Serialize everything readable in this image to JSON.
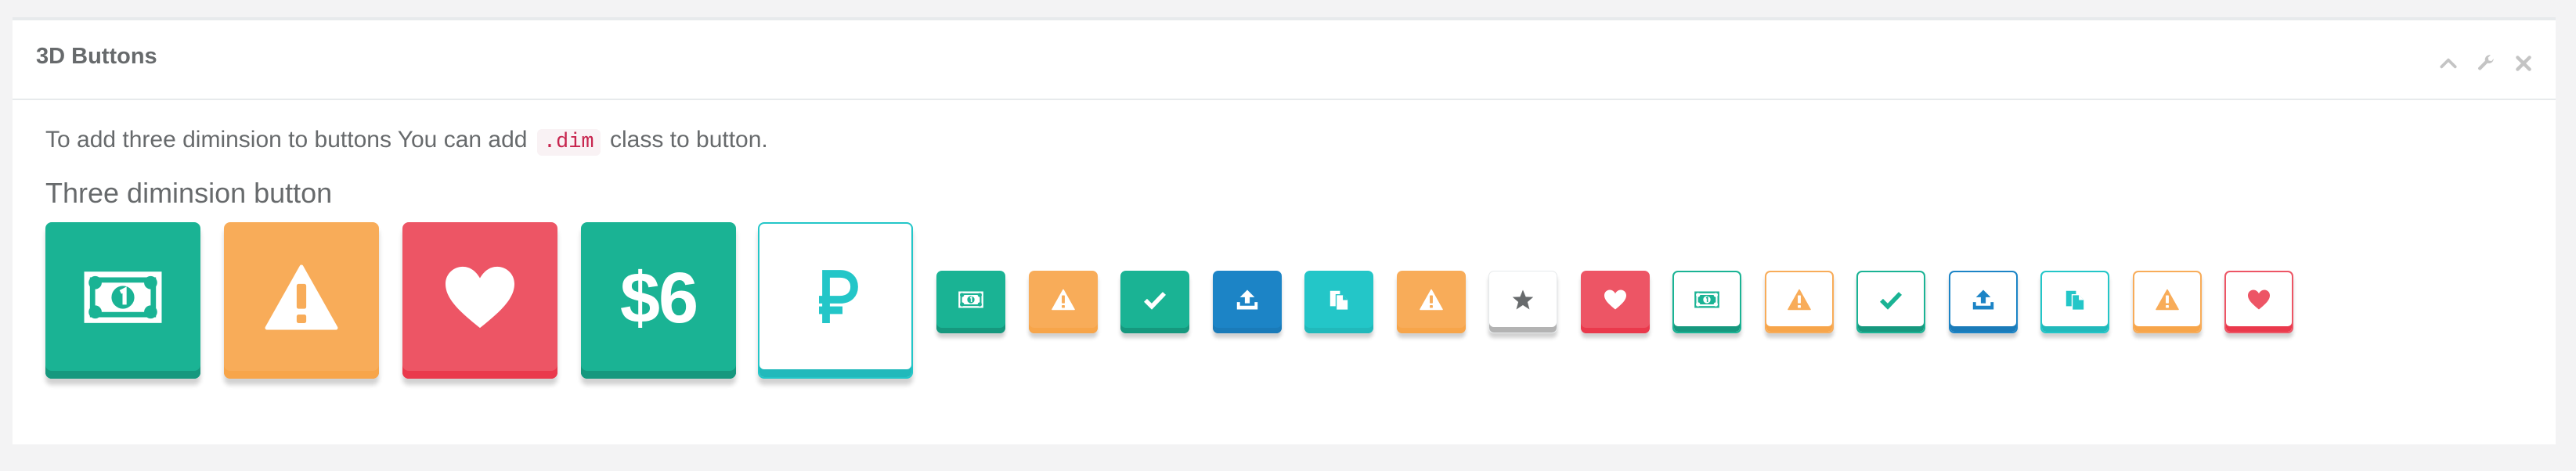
{
  "panel": {
    "title": "3D Buttons",
    "tools": [
      "chevron-up-icon",
      "wrench-icon",
      "close-icon"
    ]
  },
  "content": {
    "description_before": "To add three diminsion to buttons You can add",
    "code": ".dim",
    "description_after": "class to button.",
    "subheading": "Three diminsion button"
  },
  "colors": {
    "primary": "#1ab394",
    "primary_dark": "#16987e",
    "warning": "#f8ac59",
    "warning_dark": "#f7a54a",
    "danger": "#ed5565",
    "danger_dark": "#ea394c",
    "success": "#1c84c6",
    "success_dark": "#1a7bb9",
    "info": "#23c6c8",
    "info_dark": "#21b9bb",
    "white_border": "#e7eaec",
    "white_shadow": "#b3b3b3"
  },
  "big_buttons": [
    {
      "name": "money-button-large",
      "icon": "money-icon",
      "style": "primary"
    },
    {
      "name": "warning-button-large",
      "icon": "warning-icon",
      "style": "warning"
    },
    {
      "name": "heart-button-large",
      "icon": "heart-icon",
      "style": "danger"
    },
    {
      "name": "six-dollar-button",
      "icon": "",
      "style": "primary",
      "label": "$6"
    },
    {
      "name": "ruble-button-large",
      "icon": "ruble-icon",
      "style": "outline-info"
    }
  ],
  "small_buttons": [
    {
      "name": "money-button",
      "icon": "money-icon",
      "style": "primary"
    },
    {
      "name": "warning-button",
      "icon": "warning-icon",
      "style": "warning"
    },
    {
      "name": "check-button",
      "icon": "check-icon",
      "style": "primary"
    },
    {
      "name": "upload-button",
      "icon": "upload-icon",
      "style": "success"
    },
    {
      "name": "copy-button",
      "icon": "copy-icon",
      "style": "info"
    },
    {
      "name": "warning-button-2",
      "icon": "warning-icon",
      "style": "warning"
    },
    {
      "name": "star-button",
      "icon": "star-icon",
      "style": "white"
    },
    {
      "name": "heart-button",
      "icon": "heart-icon",
      "style": "danger"
    },
    {
      "name": "money-outline-button",
      "icon": "money-icon",
      "style": "outline-primary"
    },
    {
      "name": "warning-outline-button",
      "icon": "warning-icon",
      "style": "outline-warning"
    },
    {
      "name": "check-outline-button",
      "icon": "check-icon",
      "style": "outline-primary"
    },
    {
      "name": "upload-outline-button",
      "icon": "upload-icon",
      "style": "outline-success"
    },
    {
      "name": "copy-outline-button",
      "icon": "copy-icon",
      "style": "outline-info"
    },
    {
      "name": "warning-outline-button-2",
      "icon": "warning-icon",
      "style": "outline-warning"
    },
    {
      "name": "heart-outline-button",
      "icon": "heart-icon",
      "style": "outline-danger"
    }
  ]
}
